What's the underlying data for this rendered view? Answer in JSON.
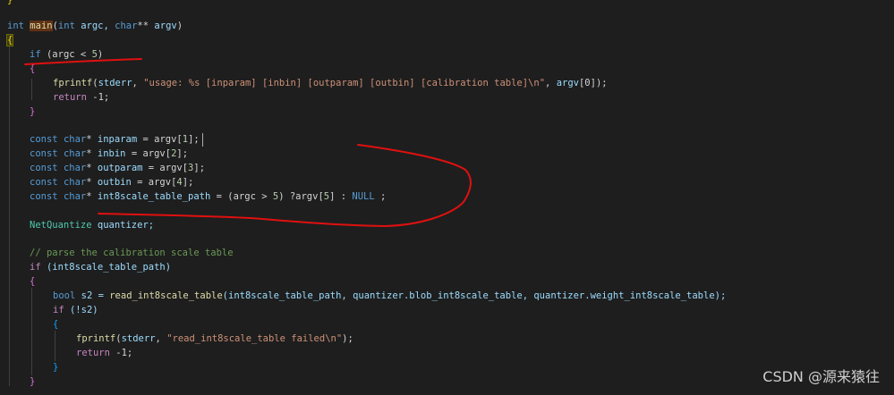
{
  "code": {
    "top_fragment": "}",
    "sig_int": "int",
    "sig_main": "main",
    "sig_args_open": "(",
    "sig_int2": "int",
    "sig_argc": " argc, ",
    "sig_char": "char",
    "sig_ptr": "** ",
    "sig_argv": "argv",
    "sig_close": ")",
    "open_brace": "{",
    "l_if": "if",
    "l_if_rest": " (argc < ",
    "l_if_num": "5",
    "l_if_close": ")",
    "brace_open": "{",
    "l_fprintf": "fprintf",
    "l_fprintf_open": "(",
    "l_stderr": "stderr",
    "l_usage_str": "\"usage: %s [inparam] [inbin] [outparam] [outbin] [calibration table]\\n\"",
    "l_fprintf_tail_a": ", ",
    "l_argv": "argv",
    "l_argv_idx": "[0]",
    "l_fprintf_end": ");",
    "l_return": "return",
    "l_return_val": " -1;",
    "brace_close": "}",
    "const": "const",
    "char": "char",
    "star": "* ",
    "inparam": "inparam",
    "inbin": "inbin",
    "outparam": "outparam",
    "outbin": "outbin",
    "int8path": "int8scale_table_path",
    "eq_argv": " = argv[",
    "idx1": "1",
    "idx2": "2",
    "idx3": "3",
    "idx4": "4",
    "tail": "];",
    "tern_a": " = (argc > ",
    "tern_num": "5",
    "tern_b": ") ?argv[",
    "tern_idx": "5",
    "tern_c": "] : ",
    "null": "NULL",
    "tern_end": " ;",
    "netq_type": "NetQuantize",
    "netq_var": " quantizer;",
    "comment": "// parse the calibration scale table",
    "if2_kw": "if",
    "if2_rest": " (int8scale_table_path)",
    "bool": "bool",
    "s2_decl": " s2 = ",
    "read_fn": "read_int8scale_table",
    "read_args": "(int8scale_table_path, quantizer.blob_int8scale_table, quantizer.weight_int8scale_table);",
    "if3_kw": "if",
    "if3_rest": " (!s2)",
    "fprintf2": "fprintf",
    "fprintf2_args_a": "(",
    "fprintf2_stderr": "stderr",
    "fprintf2_sep": ", ",
    "fprintf2_str": "\"read_int8scale_table failed\\n\"",
    "fprintf2_end": ");",
    "return2": "return",
    "return2_val": " -1;"
  },
  "watermark": "CSDN @源来猿往",
  "annotation_color": "#e01010"
}
